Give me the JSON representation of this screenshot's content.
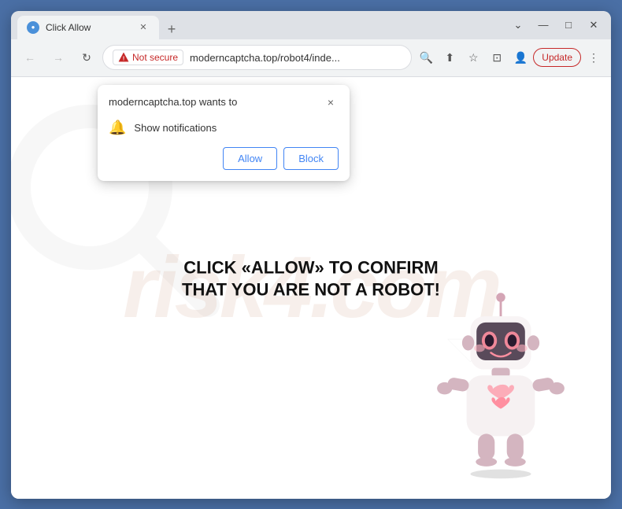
{
  "browser": {
    "tab_title": "Click Allow",
    "new_tab_icon": "+",
    "window_controls": {
      "minimize": "—",
      "maximize": "□",
      "close": "✕"
    }
  },
  "toolbar": {
    "back_label": "←",
    "forward_label": "→",
    "refresh_label": "↻",
    "security_label": "Not secure",
    "url": "moderncaptcha.top/robot4/inde...",
    "search_icon": "🔍",
    "share_icon": "⬆",
    "bookmark_icon": "☆",
    "split_icon": "⊡",
    "profile_icon": "👤",
    "update_label": "Update",
    "menu_icon": "⋮"
  },
  "notification_popup": {
    "title": "moderncaptcha.top wants to",
    "close_icon": "×",
    "permission_text": "Show notifications",
    "allow_label": "Allow",
    "block_label": "Block"
  },
  "page": {
    "main_text": "CLICK «ALLOW» TO CONFIRM THAT YOU ARE NOT A ROBOT!",
    "watermark": "risk4.com"
  }
}
